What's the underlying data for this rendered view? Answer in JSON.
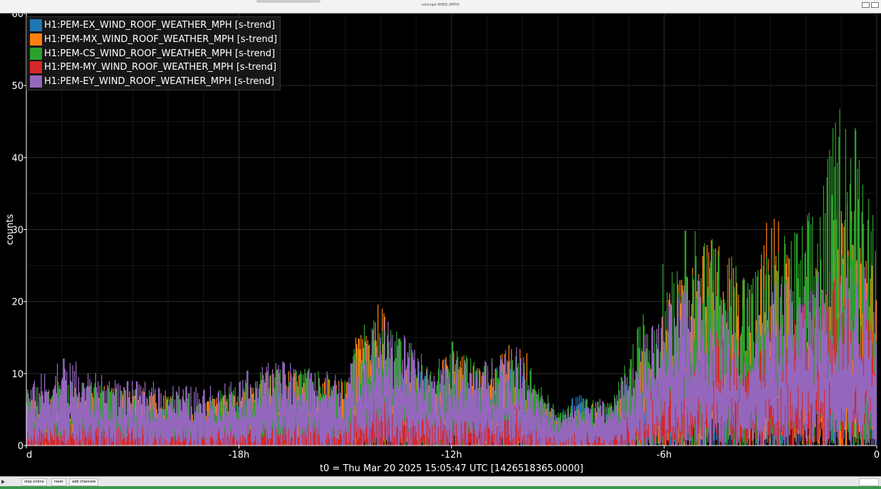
{
  "window": {
    "title": "ndscope WIND (MPH)"
  },
  "toolbar": {
    "stop_label": "stop online",
    "reset_label": "reset",
    "add_label": "add channels"
  },
  "colors": {
    "background": "#000000",
    "grid": "#2a2a2a",
    "text": "#ffffff"
  },
  "chart_data": {
    "type": "bar",
    "ylabel": "counts",
    "xlabel": "t0 = Thu Mar 20 2025 15:05:47 UTC [1426518365.0000]",
    "ylim": [
      0,
      60
    ],
    "xlim_hours": [
      -24,
      0
    ],
    "yticks": [
      "0",
      "10",
      "20",
      "30",
      "40",
      "50",
      "60"
    ],
    "xticks": [
      {
        "value": -24,
        "label": "d"
      },
      {
        "value": -18,
        "label": "-18h"
      },
      {
        "value": -12,
        "label": "-12h"
      },
      {
        "value": -6,
        "label": "-6h"
      },
      {
        "value": 0,
        "label": "0"
      }
    ],
    "grid": true,
    "legend_position": "top-left",
    "envelope_x_hours": [
      -24,
      -23,
      -22,
      -21,
      -20,
      -19,
      -18,
      -17,
      -16,
      -15,
      -14.5,
      -14,
      -13.5,
      -13,
      -12.5,
      -12,
      -11.5,
      -11,
      -10.5,
      -10,
      -9.5,
      -9,
      -8.5,
      -8,
      -7.5,
      -7,
      -6.5,
      -6,
      -5.5,
      -5,
      -4.5,
      -4,
      -3.5,
      -3,
      -2.5,
      -2,
      -1.5,
      -1,
      -0.5,
      0
    ],
    "series": [
      {
        "name": "H1:PEM-EX_WIND_ROOF_WEATHER_MPH [s-trend]",
        "color": "#1f77b4",
        "peaks": [
          6,
          7,
          6,
          6,
          5,
          5,
          6,
          8,
          7,
          8,
          14,
          14,
          13,
          11,
          9,
          11,
          10,
          10,
          12,
          10,
          7,
          4,
          8,
          5,
          5,
          9,
          7,
          9,
          10,
          12,
          12,
          12,
          10,
          10,
          11,
          12,
          13,
          15,
          17,
          16
        ]
      },
      {
        "name": "H1:PEM-MX_WIND_ROOF_WEATHER_MPH [s-trend]",
        "color": "#ff7f0e",
        "peaks": [
          7,
          8,
          9,
          8,
          7,
          6,
          8,
          11,
          10,
          9,
          19,
          20,
          15,
          12,
          10,
          14,
          12,
          11,
          14,
          15,
          8,
          4,
          5,
          6,
          5,
          10,
          14,
          20,
          25,
          27,
          30,
          26,
          22,
          34,
          30,
          25,
          28,
          34,
          35,
          23
        ]
      },
      {
        "name": "H1:PEM-CS_WIND_ROOF_WEATHER_MPH [s-trend]",
        "color": "#2ca02c",
        "peaks": [
          8,
          9,
          9,
          8,
          8,
          7,
          9,
          11,
          11,
          10,
          17,
          18,
          16,
          14,
          11,
          15,
          13,
          12,
          13,
          14,
          9,
          5,
          6,
          7,
          6,
          13,
          20,
          26,
          30,
          31,
          28,
          27,
          25,
          28,
          30,
          32,
          38,
          50,
          45,
          33
        ]
      },
      {
        "name": "H1:PEM-MY_WIND_ROOF_WEATHER_MPH [s-trend]",
        "color": "#d62728",
        "peaks": [
          3,
          3,
          3,
          3,
          2,
          2,
          3,
          3,
          3,
          3,
          6,
          7,
          6,
          5,
          4,
          5,
          4,
          4,
          5,
          6,
          3,
          2,
          2,
          2,
          3,
          5,
          7,
          9,
          12,
          14,
          16,
          14,
          12,
          15,
          17,
          20,
          22,
          24,
          26,
          20
        ]
      },
      {
        "name": "H1:PEM-EY_WIND_ROOF_WEATHER_MPH [s-trend]",
        "color": "#9467bd",
        "peaks": [
          8,
          13,
          10,
          9,
          9,
          8,
          10,
          12,
          11,
          10,
          16,
          18,
          17,
          13,
          11,
          13,
          12,
          12,
          15,
          13,
          8,
          4,
          6,
          7,
          6,
          11,
          16,
          19,
          22,
          24,
          21,
          18,
          16,
          22,
          24,
          22,
          26,
          25,
          27,
          21
        ]
      }
    ]
  }
}
